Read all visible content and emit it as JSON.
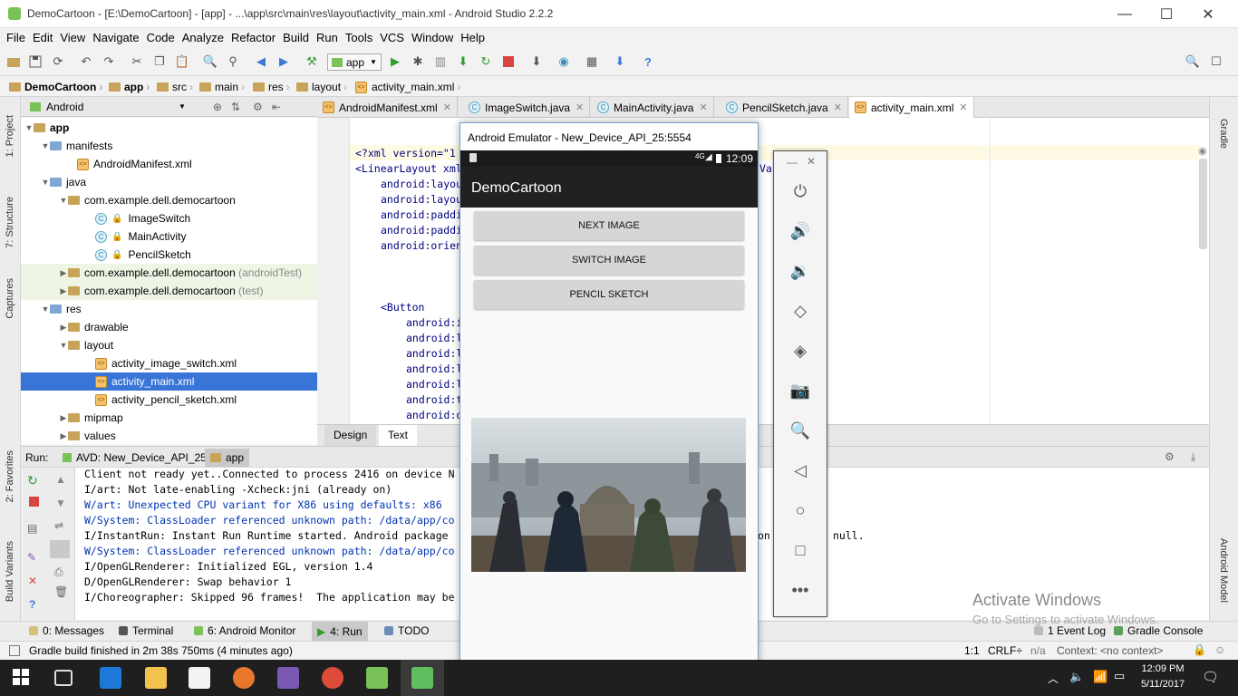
{
  "window": {
    "title": "DemoCartoon - [E:\\DemoCartoon] - [app] - ...\\app\\src\\main\\res\\layout\\activity_main.xml - Android Studio 2.2.2"
  },
  "menu": [
    "File",
    "Edit",
    "View",
    "Navigate",
    "Code",
    "Analyze",
    "Refactor",
    "Build",
    "Run",
    "Tools",
    "VCS",
    "Window",
    "Help"
  ],
  "toolbar": {
    "run_config": "app"
  },
  "breadcrumbs": [
    "DemoCartoon",
    "app",
    "src",
    "main",
    "res",
    "layout",
    "activity_main.xml"
  ],
  "side_tabs": {
    "project": "1: Project",
    "structure": "7: Structure",
    "captures": "Captures",
    "favorites": "2: Favorites",
    "build_variants": "Build Variants",
    "gradle": "Gradle",
    "android_model": "Android Model"
  },
  "project": {
    "view": "Android",
    "tree": [
      {
        "label": "app",
        "bold": true
      },
      {
        "label": "manifests"
      },
      {
        "label": "AndroidManifest.xml"
      },
      {
        "label": "java"
      },
      {
        "label": "com.example.dell.democartoon"
      },
      {
        "label": "ImageSwitch"
      },
      {
        "label": "MainActivity"
      },
      {
        "label": "PencilSketch"
      },
      {
        "label": "com.example.dell.democartoon",
        "suffix": "(androidTest)"
      },
      {
        "label": "com.example.dell.democartoon",
        "suffix": "(test)"
      },
      {
        "label": "res"
      },
      {
        "label": "drawable"
      },
      {
        "label": "layout"
      },
      {
        "label": "activity_image_switch.xml"
      },
      {
        "label": "activity_main.xml"
      },
      {
        "label": "activity_pencil_sketch.xml"
      },
      {
        "label": "mipmap"
      },
      {
        "label": "values"
      }
    ]
  },
  "editor_tabs": [
    "AndroidManifest.xml",
    "ImageSwitch.java",
    "MainActivity.java",
    "PencilSketch.java",
    "activity_main.xml"
  ],
  "code": {
    "l1": "<?xml version=\"1",
    "l2": "<LinearLayout xml",
    "l2b": "Van",
    "l3": "android:layou",
    "l4": "android:layou",
    "l5": "android:paddi",
    "l6": "android:paddi",
    "l7": "android:orien",
    "l8": "<Button",
    "l9": "android:i",
    "l10": "android:l",
    "l11": "android:l",
    "l12": "android:l",
    "l13": "android:l",
    "l14": "android:t",
    "l15": "android:o"
  },
  "design_tabs": [
    "Design",
    "Text"
  ],
  "run": {
    "label": "Run:",
    "tabs": [
      "AVD: New_Device_API_25",
      "app"
    ],
    "lines": [
      "Client not ready yet..Connected to process 2416 on device N",
      "I/art: Not late-enabling -Xcheck:jni (already on)",
      "W/art: Unexpected CPU variant for X86 using defaults: x86",
      "W/System: ClassLoader referenced unknown path: /data/app/co",
      "I/InstantRun: Instant Run Runtime started. Android package",
      "W/System: ClassLoader referenced unknown path: /data/app/co",
      "I/OpenGLRenderer: Initialized EGL, version 1.4",
      "D/OpenGLRenderer: Swap behavior 1",
      "I/Choreographer: Skipped 96 frames!  The application may be"
    ],
    "trailing": "on",
    "trailing2": "null."
  },
  "bottom_tabs": [
    "0: Messages",
    "Terminal",
    "6: Android Monitor",
    "4: Run",
    "TODO",
    "1 Event Log",
    "Gradle Console"
  ],
  "status": {
    "message": "Gradle build finished in 2m 38s 750ms (4 minutes ago)",
    "position": "1:1",
    "line_sep": "CRLF÷",
    "encoding": "n/a",
    "context": "Context: <no context>"
  },
  "emulator": {
    "title": "Android Emulator - New_Device_API_25:5554",
    "time": "12:09",
    "signal": "4G",
    "app_title": "DemoCartoon",
    "buttons": [
      "NEXT IMAGE",
      "SWITCH IMAGE",
      "PENCIL SKETCH"
    ]
  },
  "watermark": {
    "line1": "Activate Windows",
    "line2": "Go to Settings to activate Windows."
  },
  "taskbar": {
    "time": "12:09 PM",
    "date": "5/11/2017"
  },
  "colors": {
    "selection": "#3875d7",
    "android_green": "#78c257",
    "app_bar": "#212121"
  }
}
